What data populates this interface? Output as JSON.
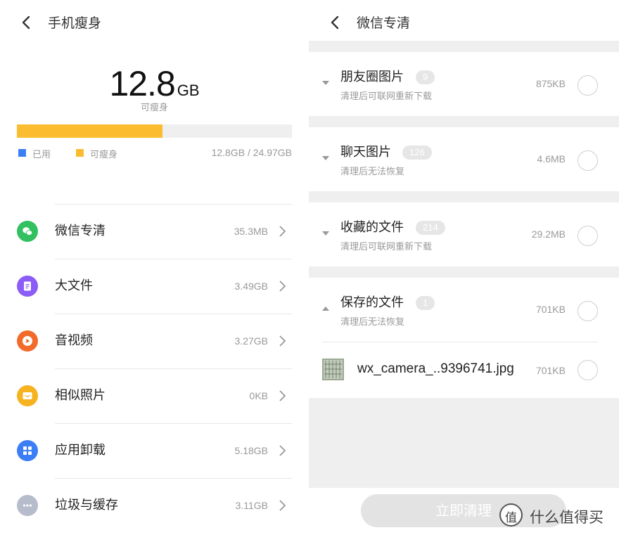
{
  "left": {
    "title": "手机瘦身",
    "size_value": "12.8",
    "size_unit": "GB",
    "size_caption": "可瘦身",
    "bar_fraction": 0.53,
    "legend_used": "已用",
    "legend_slim": "可瘦身",
    "total": "12.8GB / 24.97GB",
    "items": [
      {
        "label": "微信专清",
        "size": "35.3MB",
        "icon": "wechat-icon",
        "color": "#32c060"
      },
      {
        "label": "大文件",
        "size": "3.49GB",
        "icon": "document-icon",
        "color": "#8b5cf6"
      },
      {
        "label": "音视频",
        "size": "3.27GB",
        "icon": "play-icon",
        "color": "#f26b2a"
      },
      {
        "label": "相似照片",
        "size": "0KB",
        "icon": "photo-icon",
        "color": "#f6b21f"
      },
      {
        "label": "应用卸载",
        "size": "5.18GB",
        "icon": "apps-grid-icon",
        "color": "#3b7ef6"
      },
      {
        "label": "垃圾与缓存",
        "size": "3.11GB",
        "icon": "more-dots-icon",
        "color": "#b7bccc"
      }
    ]
  },
  "right": {
    "title": "微信专清",
    "groups": [
      {
        "label": "朋友圈图片",
        "count": "9",
        "desc": "清理后可联网重新下载",
        "size": "875KB",
        "expanded": false
      },
      {
        "label": "聊天图片",
        "count": "126",
        "desc": "清理后无法恢复",
        "size": "4.6MB",
        "expanded": false
      },
      {
        "label": "收藏的文件",
        "count": "214",
        "desc": "清理后可联网重新下载",
        "size": "29.2MB",
        "expanded": false
      },
      {
        "label": "保存的文件",
        "count": "1",
        "desc": "清理后无法恢复",
        "size": "701KB",
        "expanded": true
      }
    ],
    "file": {
      "name": "wx_camera_..9396741.jpg",
      "size": "701KB"
    },
    "clean_button": "立即清理"
  },
  "watermark": {
    "symbol": "值",
    "text": "什么值得买"
  },
  "colors": {
    "used": "#3c7ff5",
    "slimmable": "#fbbc2f",
    "separator": "#e8e8e8",
    "page_gray": "#efefef"
  }
}
